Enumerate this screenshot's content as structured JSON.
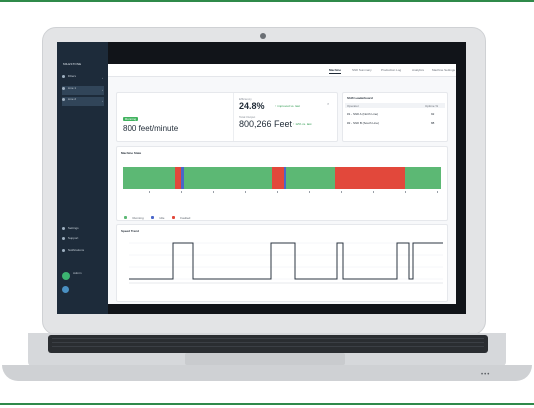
{
  "app": {
    "brand": "MILESTONE",
    "sidebar": {
      "items": [
        {
          "label": "Filters"
        },
        {
          "label": "Line 1"
        },
        {
          "label": "Line 2"
        },
        {
          "label": "Settings"
        },
        {
          "label": "Support"
        },
        {
          "label": "Notifications"
        },
        {
          "label": "Admin"
        }
      ]
    },
    "tabs": [
      "Machine",
      "Shift Summary",
      "Production Log",
      "Analytics",
      "Machine Settings"
    ],
    "kpis": {
      "speed_badge": "Running",
      "speed_value": "800 feet/minute",
      "efficiency_label": "Efficiency",
      "efficiency_value": "24.8%",
      "efficiency_note": "↑ improved vs. last",
      "output_label": "Total Output",
      "output_value": "800,266 Feet",
      "output_note": "↑ 12% vs. last"
    },
    "leaderboard": {
      "title": "Shift Leaderboard",
      "columns": [
        "Operator",
        "Uptime %"
      ],
      "rows": [
        {
          "name": "#1 - Shift A (North Line)",
          "value": "92"
        },
        {
          "name": "#2 - Shift B (South Line)",
          "value": "88"
        }
      ]
    },
    "machine_state": {
      "title": "Machine State",
      "legend": [
        {
          "label": "Running",
          "color": "#5cb874"
        },
        {
          "label": "Idle",
          "color": "#4a66c9"
        },
        {
          "label": "Faulted",
          "color": "#e2483b"
        }
      ]
    },
    "speed_trend": {
      "title": "Speed Trend"
    }
  }
}
